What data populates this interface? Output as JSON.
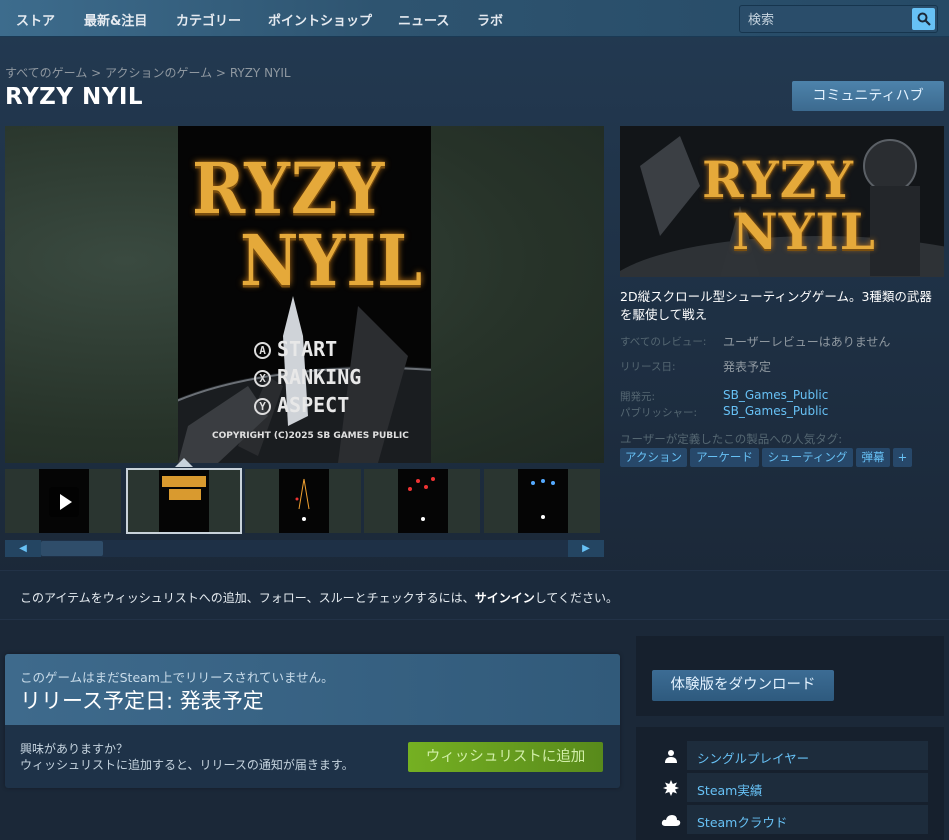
{
  "nav": {
    "items": [
      "ストア",
      "最新&注目",
      "カテゴリー",
      "ポイントショップ",
      "ニュース",
      "ラボ"
    ],
    "search_placeholder": "検索"
  },
  "breadcrumb": [
    "すべてのゲーム",
    "アクションのゲーム",
    "RYZY NYIL"
  ],
  "breadcrumb_sep": ">",
  "title": "RYZY NYIL",
  "community_hub": "コミュニティハブ",
  "main_screenshot": {
    "logo_line1": "RYZY",
    "logo_line2": "NYIL",
    "menu": [
      {
        "button": "A",
        "label": "START"
      },
      {
        "button": "X",
        "label": "RANKING"
      },
      {
        "button": "Y",
        "label": "ASPECT"
      }
    ],
    "copyright": "COPYRIGHT (C)2025 SB GAMES PUBLIC"
  },
  "header_capsule": {
    "logo_line1": "RYZY",
    "logo_line2": "NYIL"
  },
  "description": "2D縦スクロール型シューティングゲーム。3種類の武器を駆使して戦え",
  "info": {
    "reviews_label": "すべてのレビュー:",
    "reviews_value": "ユーザーレビューはありません",
    "release_label": "リリース日:",
    "release_value": "発表予定",
    "developer_label": "開発元:",
    "developer_value": "SB_Games_Public",
    "publisher_label": "パブリッシャー:",
    "publisher_value": "SB_Games_Public"
  },
  "tags_label": "ユーザーが定義したこの製品への人気タグ:",
  "tags": [
    "アクション",
    "アーケード",
    "シューティング",
    "弾幕",
    "+"
  ],
  "signin": {
    "before": "このアイテムをウィッシュリストへの追加、フォロー、スルーとチェックするには、",
    "link": "サインイン",
    "after": "してください。"
  },
  "release_box": {
    "subtitle": "このゲームはまだSteam上でリリースされていません。",
    "date": "リリース予定日: 発表予定",
    "question": "興味がありますか？",
    "sub": "ウィッシュリストに追加すると、リリースの通知が届きます。",
    "wishlist_button": "ウィッシュリストに追加"
  },
  "demo_button": "体験版をダウンロード",
  "features": [
    {
      "icon": "single-player-icon",
      "label": "シングルプレイヤー"
    },
    {
      "icon": "achievements-icon",
      "label": "Steam実績"
    },
    {
      "icon": "cloud-icon",
      "label": "Steamクラウド"
    }
  ],
  "colors": {
    "accent_blue": "#67c1f5",
    "wishlist_green": "#75b022",
    "logo_gold": "#e5a93a"
  }
}
